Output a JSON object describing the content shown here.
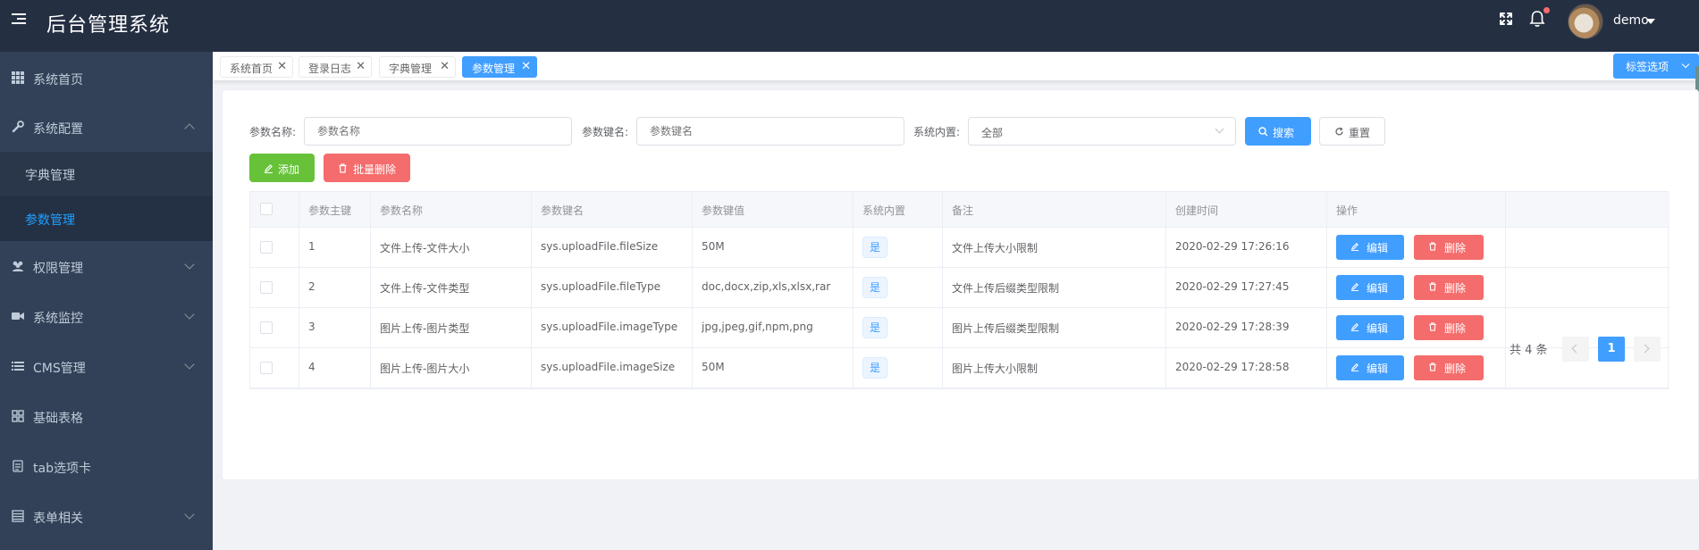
{
  "header": {
    "title": "后台管理系统",
    "user_name": "demo",
    "icons": [
      "menu-toggle-icon",
      "fullscreen-icon",
      "bell-icon"
    ]
  },
  "sidebar": {
    "items": [
      {
        "label": "系统首页",
        "icon": "grid-icon"
      },
      {
        "label": "系统配置",
        "icon": "wrench-icon",
        "expanded": true,
        "children": [
          {
            "label": "字典管理"
          },
          {
            "label": "参数管理",
            "active": true
          }
        ]
      },
      {
        "label": "权限管理",
        "icon": "users-icon"
      },
      {
        "label": "系统监控",
        "icon": "camera-icon"
      },
      {
        "label": "CMS管理",
        "icon": "list-icon"
      },
      {
        "label": "基础表格",
        "icon": "table-icon"
      },
      {
        "label": "tab选项卡",
        "icon": "tab-icon"
      },
      {
        "label": "表单相关",
        "icon": "form-icon"
      }
    ]
  },
  "tags": {
    "items": [
      {
        "label": "系统首页"
      },
      {
        "label": "登录日志"
      },
      {
        "label": "字典管理"
      },
      {
        "label": "参数管理",
        "active": true
      }
    ],
    "close_glyph": "✕",
    "options_label": "标签选项"
  },
  "filters": {
    "param_name_label": "参数名称:",
    "param_name_placeholder": "参数名称",
    "param_key_label": "参数键名:",
    "param_key_placeholder": "参数键名",
    "builtin_label": "系统内置:",
    "builtin_value": "全部",
    "search_label": "搜索",
    "reset_label": "重置"
  },
  "actions": {
    "add_label": "添加",
    "batch_delete_label": "批量删除"
  },
  "table": {
    "columns": [
      "",
      "参数主键",
      "参数名称",
      "参数键名",
      "参数键值",
      "系统内置",
      "备注",
      "创建时间",
      "操作"
    ],
    "rows": [
      {
        "id": "1",
        "name": "文件上传-文件大小",
        "key": "sys.uploadFile.fileSize",
        "value": "50M",
        "builtin": "是",
        "remark": "文件上传大小限制",
        "created": "2020-02-29 17:26:16"
      },
      {
        "id": "2",
        "name": "文件上传-文件类型",
        "key": "sys.uploadFile.fileType",
        "value": "doc,docx,zip,xls,xlsx,rar",
        "builtin": "是",
        "remark": "文件上传后缀类型限制",
        "created": "2020-02-29 17:27:45"
      },
      {
        "id": "3",
        "name": "图片上传-图片类型",
        "key": "sys.uploadFile.imageType",
        "value": "jpg,jpeg,gif,npm,png",
        "builtin": "是",
        "remark": "图片上传后缀类型限制",
        "created": "2020-02-29 17:28:39"
      },
      {
        "id": "4",
        "name": "图片上传-图片大小",
        "key": "sys.uploadFile.imageSize",
        "value": "50M",
        "builtin": "是",
        "remark": "图片上传大小限制",
        "created": "2020-02-29 17:28:58"
      }
    ],
    "edit_label": "编辑",
    "delete_label": "删除"
  },
  "pagination": {
    "total_text": "共 4 条",
    "current_page": "1"
  },
  "colors": {
    "header_bg": "#242f42",
    "sidebar_bg": "#324157",
    "primary": "#409eff",
    "success": "#67c23a",
    "danger": "#f56c6c",
    "active_menu_text": "#20a0ff"
  }
}
